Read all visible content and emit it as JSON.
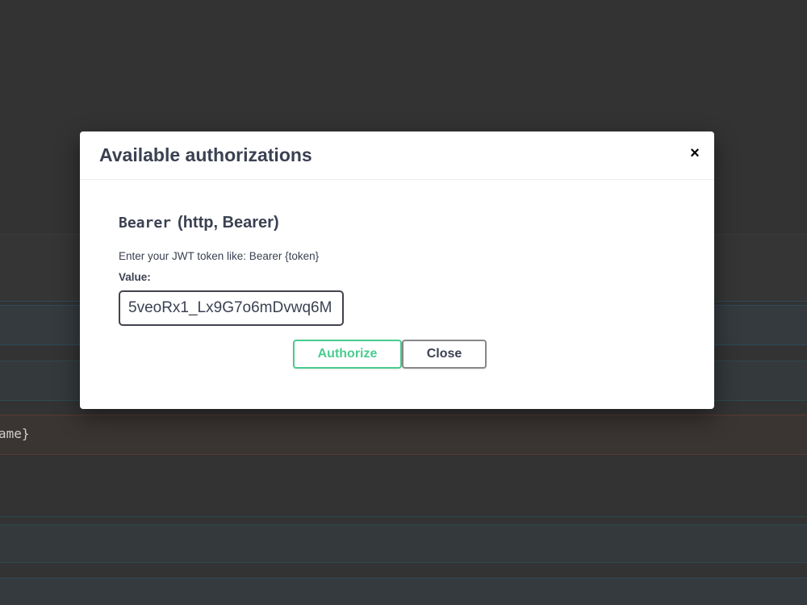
{
  "background": {
    "path_fragment": "ame}"
  },
  "modal": {
    "title": "Available authorizations",
    "close_icon": "×",
    "scheme": {
      "name": "Bearer",
      "type": "(http, Bearer)",
      "description": "Enter your JWT token like: Bearer {token}",
      "value_label": "Value:",
      "value": "5veoRx1_Lx9G7o6mDvwq6M"
    },
    "buttons": {
      "authorize": "Authorize",
      "close": "Close"
    }
  },
  "colors": {
    "overlay": "#333333",
    "authorize_accent": "#49cc90",
    "text": "#3b4151"
  }
}
